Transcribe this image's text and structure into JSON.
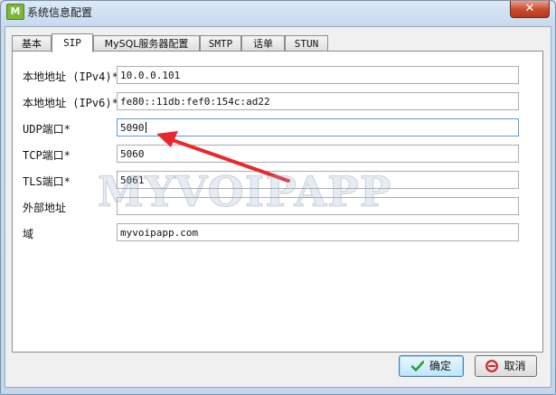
{
  "window": {
    "title": "系统信息配置",
    "icon_text": "M",
    "close_glyph": "✕"
  },
  "tabs": [
    {
      "label": "基本"
    },
    {
      "label": "SIP"
    },
    {
      "label": "MySQL服务器配置"
    },
    {
      "label": "SMTP"
    },
    {
      "label": "话单"
    },
    {
      "label": "STUN"
    }
  ],
  "active_tab": "SIP",
  "fields": [
    {
      "label": "本地地址 (IPv4)*",
      "value": "10.0.0.101"
    },
    {
      "label": "本地地址 (IPv6)*",
      "value": "fe80::11db:fef0:154c:ad22"
    },
    {
      "label": "UDP端口*",
      "value": "5090"
    },
    {
      "label": "TCP端口*",
      "value": "5060"
    },
    {
      "label": "TLS端口*",
      "value": "5061"
    },
    {
      "label": "外部地址",
      "value": ""
    },
    {
      "label": "域",
      "value": "myvoipapp.com"
    }
  ],
  "watermark": "MYVOIPAPP",
  "buttons": {
    "ok": "确定",
    "cancel": "取消"
  },
  "icons": {
    "app": "app-icon",
    "close": "close-icon",
    "ok": "checkmark-icon",
    "cancel": "no-entry-icon"
  },
  "colors": {
    "arrow": "#e8282b",
    "ok_icon": "#2f9e2f",
    "cancel_icon": "#d42020",
    "close_button": "#c74a2c"
  }
}
